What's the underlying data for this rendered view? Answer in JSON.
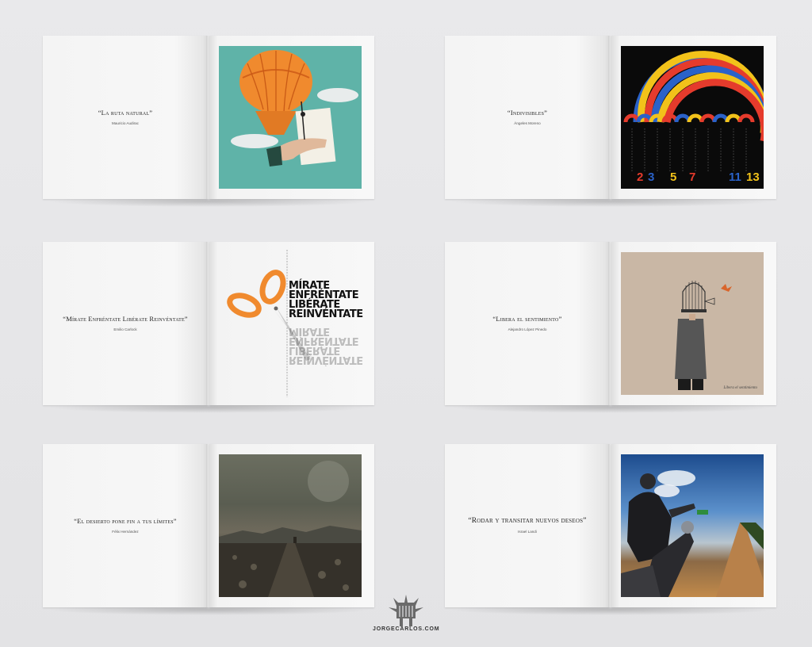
{
  "spreads": [
    {
      "quote": "“La ruta natural”",
      "author": "Mauricio Audirac"
    },
    {
      "quote": "“Indivisibles”",
      "author": "Ángeles Moreno",
      "art": {
        "numbers": [
          "2",
          "3",
          "5",
          "7",
          "11",
          "13"
        ]
      }
    },
    {
      "quote": "“Mírate Enfréntate Libérate Reinvéntate”",
      "author": "Emilio Carlock",
      "art": {
        "words": [
          "MÍRATE",
          "ENFRÉNTATE",
          "LIBÉRATE",
          "REINVÉNTATE"
        ]
      }
    },
    {
      "quote": "“Libera el sentimiento”",
      "author": "Alejandro López Pinedo",
      "art": {
        "signature": "Libera el sentimiento"
      }
    },
    {
      "quote": "“El desierto pone fin a tus límites”",
      "author": "Félix Hernández"
    },
    {
      "quote": "“Rodar y transitar nuevos deseos”",
      "author": "Israel Landi"
    }
  ],
  "colors": {
    "background": "#e6e6e8",
    "teal": "#5fb3a8",
    "orange": "#f08a2e",
    "prime_colors": [
      "#e53b2c",
      "#2a62c9",
      "#f2c21a",
      "#e53b2c",
      "#2a62c9",
      "#f2c21a"
    ]
  },
  "brand": {
    "name": "JORGECARLOS.COM"
  }
}
